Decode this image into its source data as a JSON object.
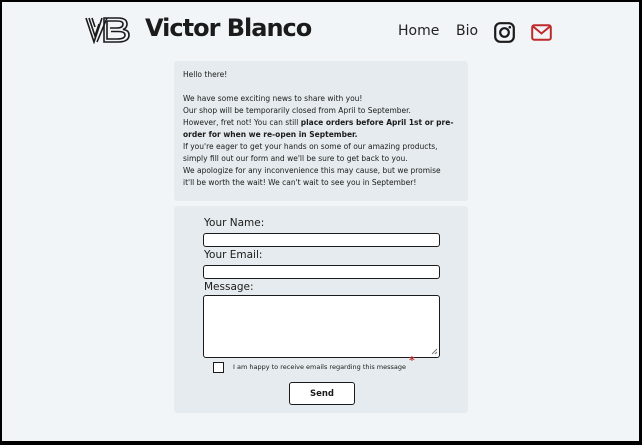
{
  "header": {
    "brand": "Victor Blanco",
    "nav": {
      "home": "Home",
      "bio": "Bio"
    },
    "icons": [
      "vb-logo-icon",
      "instagram-icon",
      "mail-icon"
    ],
    "accent_color": "#c02a2a"
  },
  "notice": {
    "greeting": "Hello there!",
    "line1": "We have some exciting news to share with you!",
    "line2": "Our shop will be temporarily closed from April to September.",
    "line3_start": "However, fret not! You can still ",
    "line3_bold_a": "place orders before April 1st or pre-",
    "line3_bold_b": "order for when we re-open in September.",
    "line4": "If you're eager to get your hands on some of our amazing products,",
    "line5": "simply fill out our form and we'll be sure to get back to you.",
    "line6": "We apologize for any inconvenience this may cause, but we promise",
    "line7": "it'll be worth the wait! We can't wait to see you in September!"
  },
  "form": {
    "name_label": "Your Name:",
    "name_value": "",
    "email_label": "Your Email:",
    "email_value": "",
    "message_label": "Message:",
    "message_value": "",
    "consent_label": "I am happy to receive emails regarding this message",
    "consent_checked": false,
    "required_marker": "*",
    "send_label": "Send"
  }
}
